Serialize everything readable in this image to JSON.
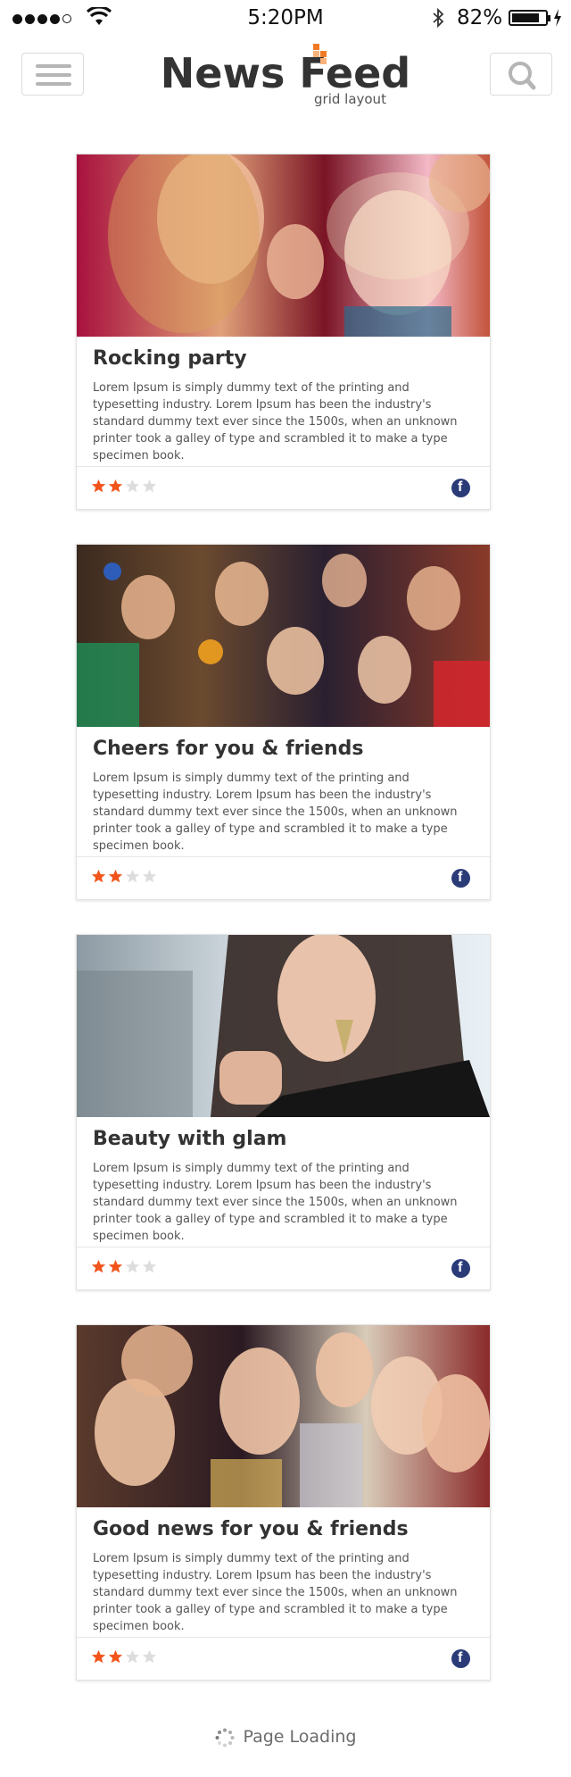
{
  "status_bar": {
    "time": "5:20PM",
    "battery_percent": "82%",
    "battery_level": 0.82,
    "signal_bars": 4,
    "signal_max": 5
  },
  "header": {
    "title": "News Feed",
    "subtitle": "grid layout",
    "menu_icon": "hamburger-menu-icon",
    "search_icon": "search-icon",
    "accent_color": "#f07a24"
  },
  "cards": [
    {
      "title": "Rocking party",
      "text": "Lorem Ipsum is simply dummy text of the printing and typesetting industry. Lorem Ipsum has been the industry's standard dummy text ever since the 1500s, when an unknown printer took a galley of type and scrambled it to make a type specimen book.",
      "rating": 2,
      "rating_max": 4
    },
    {
      "title": "Cheers for you & friends",
      "text": "Lorem Ipsum is simply dummy text of the printing and typesetting industry. Lorem Ipsum has been the industry's standard dummy text ever since the 1500s, when an unknown printer took a galley of type and scrambled it to make a type specimen book.",
      "rating": 2,
      "rating_max": 4
    },
    {
      "title": "Beauty with glam",
      "text": "Lorem Ipsum is simply dummy text of the printing and typesetting industry. Lorem Ipsum has been the industry's standard dummy text ever since the 1500s, when an unknown printer took a galley of type and scrambled it to make a type specimen book.",
      "rating": 2,
      "rating_max": 4
    },
    {
      "title": "Good news for you & friends",
      "text": "Lorem Ipsum is simply dummy text of the printing and typesetting industry. Lorem Ipsum has been the industry's standard dummy text ever since the 1500s, when an unknown printer took a galley of type and scrambled it to make a type specimen book.",
      "rating": 2,
      "rating_max": 4
    }
  ],
  "star_color": "#f2541b",
  "star_empty_color": "#dddddd",
  "facebook_color": "#2a3b78",
  "footer": {
    "loading_text": "Page Loading"
  }
}
